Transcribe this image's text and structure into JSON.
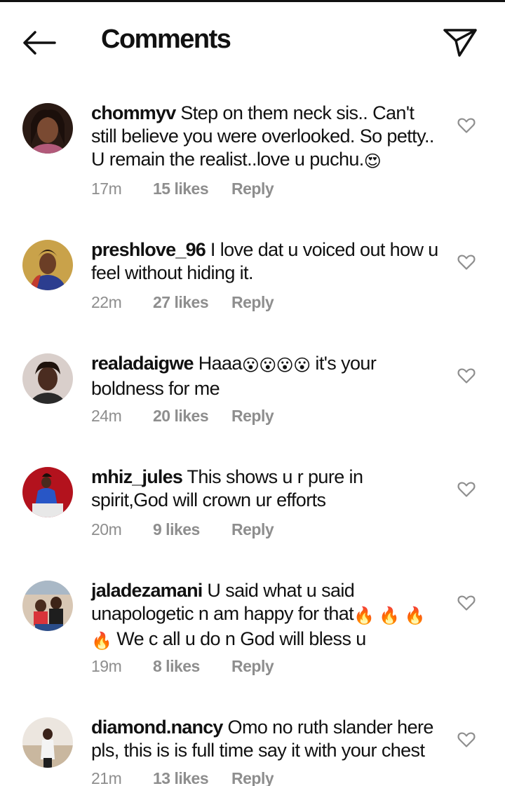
{
  "header": {
    "title": "Comments",
    "back_icon": "arrow-left-icon",
    "share_icon": "paper-plane-icon"
  },
  "reply_label": "Reply",
  "comments": [
    {
      "username": "chommyv",
      "text": "Step on them neck sis.. Can't still believe you were overlooked. So petty.. U remain the realist..love u puchu.",
      "emoji_end": "😍",
      "time": "17m",
      "likes": "15 likes"
    },
    {
      "username": "preshlove_96",
      "text": "I love dat u voiced out how u feel without hiding it.",
      "time": "22m",
      "likes": "27 likes"
    },
    {
      "username": "realadaigwe",
      "text_before": "Haaa",
      "emojis": "😮😮😮😮",
      "text_after": " it's your boldness for me",
      "time": "24m",
      "likes": "20 likes"
    },
    {
      "username": "mhiz_jules",
      "text": "This shows u r pure in spirit,God will crown ur efforts",
      "time": "20m",
      "likes": "9 likes"
    },
    {
      "username": "jaladezamani",
      "text_before": "U said what u said unapologetic n am happy for that",
      "emojis": "🔥 🔥 🔥 🔥",
      "text_after": " We c all u do n God will bless u",
      "time": "19m",
      "likes": "8 likes"
    },
    {
      "username": "diamond.nancy",
      "text": "Omo no ruth slander here pls, this is is full time say it with your chest",
      "time": "21m",
      "likes": "13 likes"
    }
  ]
}
